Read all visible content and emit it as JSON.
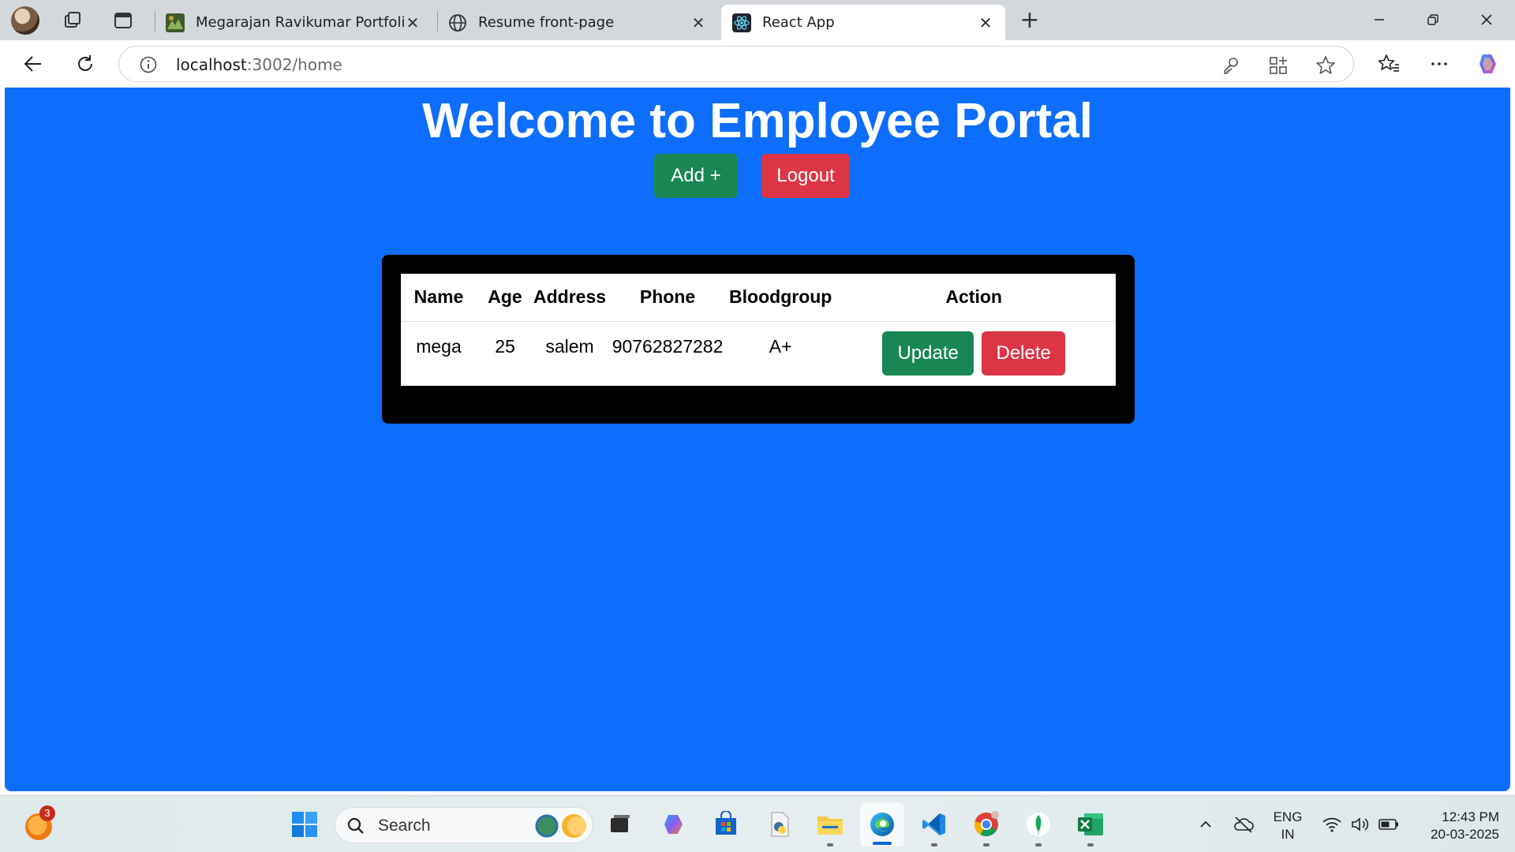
{
  "browser": {
    "tabs": [
      {
        "title": "Megarajan Ravikumar Portfolio",
        "favicon": "portfolio-image-icon",
        "active": false
      },
      {
        "title": "Resume front-page",
        "favicon": "globe-icon",
        "active": false
      },
      {
        "title": "React App",
        "favicon": "react-icon",
        "active": true
      }
    ],
    "close_glyph": "✕",
    "new_tab_glyph": "+",
    "address": {
      "host": "localhost",
      "path": ":3002/home"
    }
  },
  "page": {
    "title": "Welcome to Employee Portal",
    "add_button": "Add +",
    "logout_button": "Logout",
    "table": {
      "headers": [
        "Name",
        "Age",
        "Address",
        "Phone",
        "Bloodgroup",
        "Action"
      ],
      "rows": [
        {
          "name": "mega",
          "age": "25",
          "address": "salem",
          "phone": "90762827282",
          "bloodgroup": "A+",
          "update": "Update",
          "delete": "Delete"
        }
      ]
    },
    "colors": {
      "background": "#0d6efd",
      "success": "#198754",
      "danger": "#dc3545",
      "card": "#000000"
    }
  },
  "taskbar": {
    "notification_badge": "3",
    "search_placeholder": "Search",
    "language": {
      "line1": "ENG",
      "line2": "IN"
    },
    "time": "12:43 PM",
    "date": "20-03-2025"
  }
}
